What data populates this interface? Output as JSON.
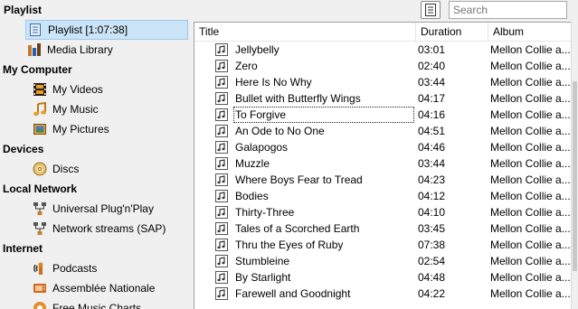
{
  "header": {
    "title": "Playlist",
    "search_placeholder": "Search",
    "view_icon": "list-view-icon"
  },
  "sidebar": {
    "playlist_item": "Playlist [1:07:38]",
    "media_library": "Media Library",
    "sections": {
      "my_computer": "My Computer",
      "devices": "Devices",
      "local_network": "Local Network",
      "internet": "Internet"
    },
    "my_computer_items": [
      "My Videos",
      "My Music",
      "My Pictures"
    ],
    "devices_items": [
      "Discs"
    ],
    "local_network_items": [
      "Universal Plug'n'Play",
      "Network streams (SAP)"
    ],
    "internet_items": [
      "Podcasts",
      "Assemblée Nationale",
      "Free Music Charts"
    ]
  },
  "table": {
    "columns": [
      "Title",
      "Duration",
      "Album"
    ],
    "rows": [
      {
        "title": "Jellybelly",
        "duration": "03:01",
        "album": "Mellon Collie a..."
      },
      {
        "title": "Zero",
        "duration": "02:40",
        "album": "Mellon Collie a..."
      },
      {
        "title": "Here Is No Why",
        "duration": "03:44",
        "album": "Mellon Collie a..."
      },
      {
        "title": "Bullet with Butterfly Wings",
        "duration": "04:17",
        "album": "Mellon Collie a..."
      },
      {
        "title": "To Forgive",
        "duration": "04:16",
        "album": "Mellon Collie a..."
      },
      {
        "title": "An Ode to No One",
        "duration": "04:51",
        "album": "Mellon Collie a..."
      },
      {
        "title": "Galapogos",
        "duration": "04:46",
        "album": "Mellon Collie a..."
      },
      {
        "title": "Muzzle",
        "duration": "03:44",
        "album": "Mellon Collie a..."
      },
      {
        "title": "Where Boys Fear to Tread",
        "duration": "04:23",
        "album": "Mellon Collie a..."
      },
      {
        "title": "Bodies",
        "duration": "04:12",
        "album": "Mellon Collie a..."
      },
      {
        "title": "Thirty-Three",
        "duration": "04:10",
        "album": "Mellon Collie a..."
      },
      {
        "title": "Tales of a Scorched Earth",
        "duration": "03:45",
        "album": "Mellon Collie a..."
      },
      {
        "title": "Thru the Eyes of Ruby",
        "duration": "07:38",
        "album": "Mellon Collie a..."
      },
      {
        "title": "Stumbleine",
        "duration": "02:54",
        "album": "Mellon Collie a..."
      },
      {
        "title": "By Starlight",
        "duration": "04:48",
        "album": "Mellon Collie a..."
      },
      {
        "title": "Farewell and Goodnight",
        "duration": "04:22",
        "album": "Mellon Collie a..."
      }
    ]
  },
  "colors": {
    "selection_bg": "#cce4f7",
    "selection_border": "#99c9ef",
    "panel_bg": "#f0f0f0",
    "list_bg": "#ffffff"
  }
}
